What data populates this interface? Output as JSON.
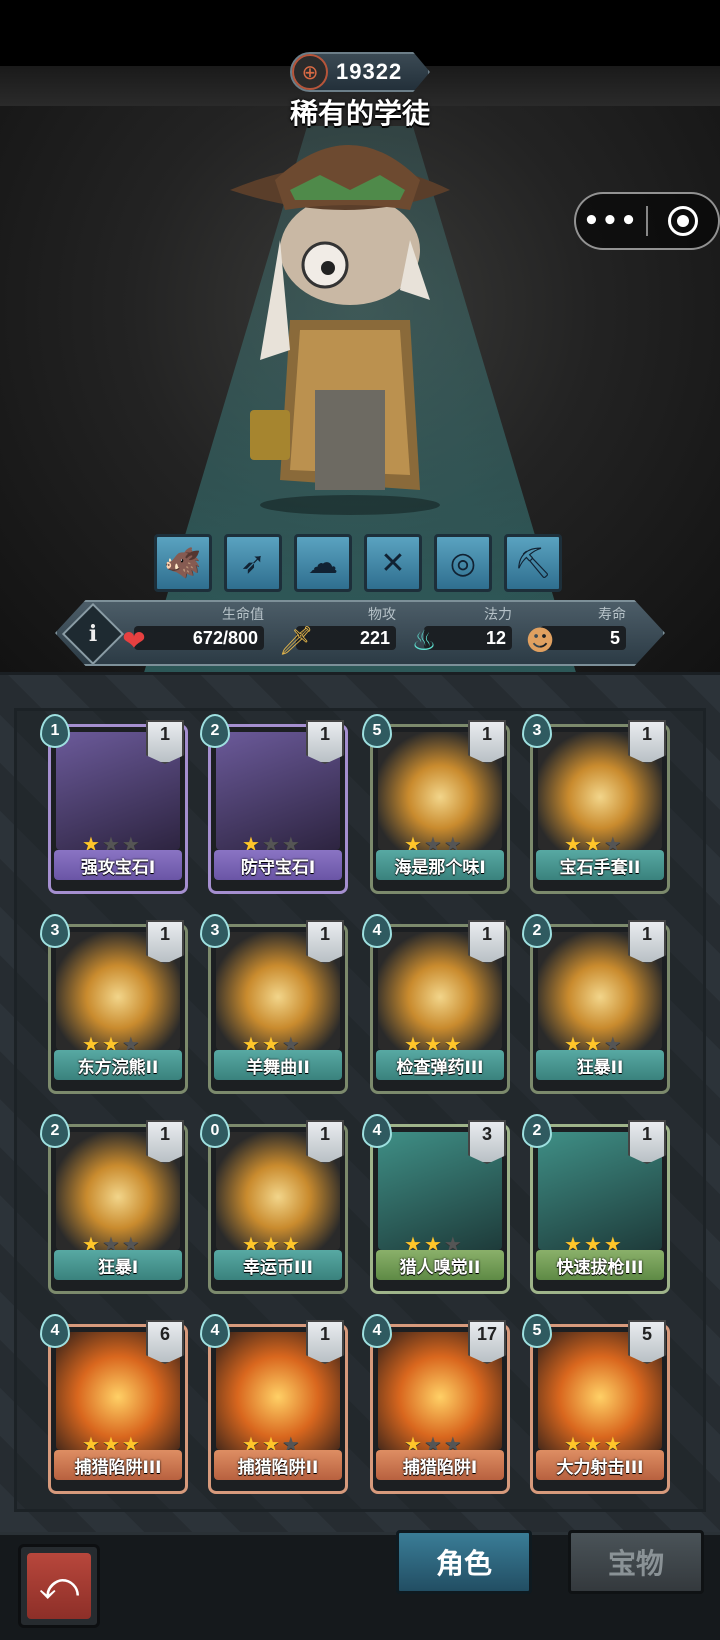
{
  "header": {
    "score": "19322",
    "character_title": "稀有的学徒"
  },
  "capsule": {
    "more_icon": "more-icon",
    "record_icon": "record-icon"
  },
  "skills": [
    "boar-icon",
    "bow-icon",
    "spirit-icon",
    "crossed-guns-icon",
    "cyclone-icon",
    "pickaxe-icon"
  ],
  "stats": {
    "hp": {
      "label": "生命值",
      "value": "672/800"
    },
    "attack": {
      "label": "物攻",
      "value": "221"
    },
    "mana": {
      "label": "法力",
      "value": "12"
    },
    "life": {
      "label": "寿命",
      "value": "5"
    }
  },
  "cards": [
    {
      "name": "强攻宝石I",
      "cost": "1",
      "level": "1",
      "stars": 1,
      "color": "purple"
    },
    {
      "name": "防守宝石I",
      "cost": "2",
      "level": "1",
      "stars": 1,
      "color": "purple"
    },
    {
      "name": "海是那个味I",
      "cost": "5",
      "level": "1",
      "stars": 1,
      "color": "teal"
    },
    {
      "name": "宝石手套II",
      "cost": "3",
      "level": "1",
      "stars": 2,
      "color": "teal"
    },
    {
      "name": "东方浣熊II",
      "cost": "3",
      "level": "1",
      "stars": 2,
      "color": "teal"
    },
    {
      "name": "羊舞曲II",
      "cost": "3",
      "level": "1",
      "stars": 2,
      "color": "teal"
    },
    {
      "name": "检查弹药III",
      "cost": "4",
      "level": "1",
      "stars": 3,
      "color": "teal"
    },
    {
      "name": "狂暴II",
      "cost": "2",
      "level": "1",
      "stars": 2,
      "color": "teal"
    },
    {
      "name": "狂暴I",
      "cost": "2",
      "level": "1",
      "stars": 1,
      "color": "teal"
    },
    {
      "name": "幸运币III",
      "cost": "0",
      "level": "1",
      "stars": 3,
      "color": "teal"
    },
    {
      "name": "猎人嗅觉II",
      "cost": "4",
      "level": "3",
      "stars": 2,
      "color": "green"
    },
    {
      "name": "快速拔枪III",
      "cost": "2",
      "level": "1",
      "stars": 3,
      "color": "green"
    },
    {
      "name": "捕猎陷阱III",
      "cost": "4",
      "level": "6",
      "stars": 3,
      "color": "orange"
    },
    {
      "name": "捕猎陷阱II",
      "cost": "4",
      "level": "1",
      "stars": 2,
      "color": "orange"
    },
    {
      "name": "捕猎陷阱I",
      "cost": "4",
      "level": "17",
      "stars": 1,
      "color": "orange"
    },
    {
      "name": "大力射击III",
      "cost": "5",
      "level": "5",
      "stars": 3,
      "color": "orange"
    }
  ],
  "bottom": {
    "tab_role": "角色",
    "tab_treasure": "宝物",
    "back_icon": "back-arrow-icon"
  }
}
